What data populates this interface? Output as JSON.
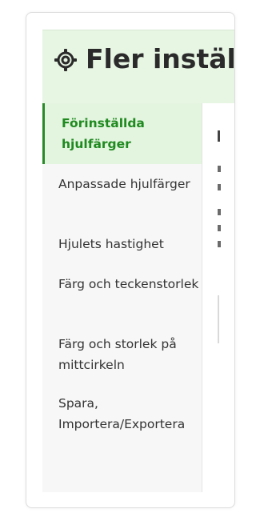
{
  "dialog": {
    "title": "Fler inställ",
    "title_icon": "gear-icon",
    "accent_color": "#1f8a1f",
    "header_bg": "#e7f5e3"
  },
  "sidebar": {
    "items": [
      {
        "label": "Förinställda hjulfärger",
        "active": true
      },
      {
        "label": "Anpassade hjulfärger",
        "active": false
      },
      {
        "label": "Hjulets hastighet",
        "active": false
      },
      {
        "label": "Färg och teckenstorlek",
        "active": false
      },
      {
        "label": "Färg och storlek på mittcirkeln",
        "active": false
      },
      {
        "label": "Spara, Importera/Exportera",
        "active": false
      }
    ]
  }
}
